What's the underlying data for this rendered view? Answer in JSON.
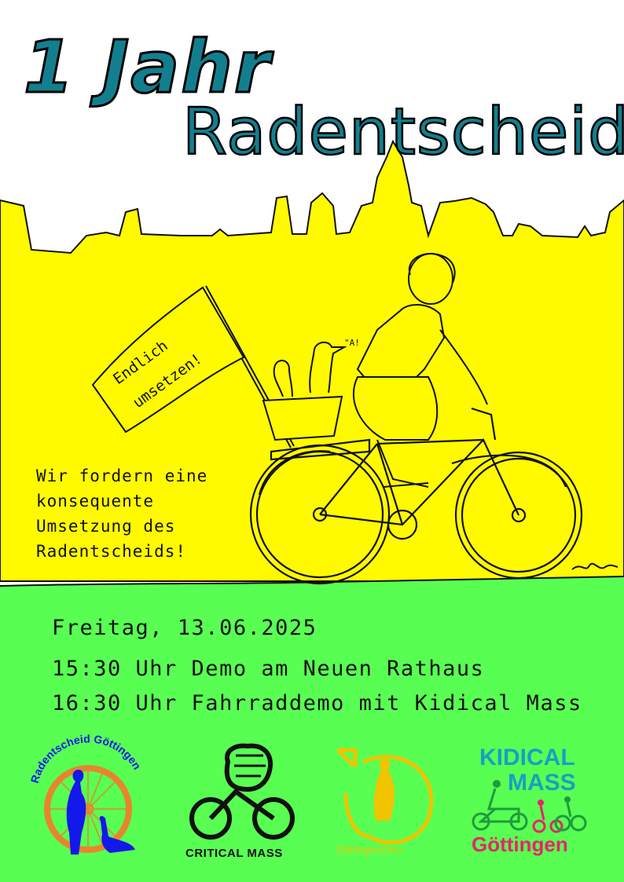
{
  "title": {
    "line1": "1 Jahr",
    "line2": "Radentscheid"
  },
  "flag_text": {
    "line1": "Endlich",
    "line2": "umsetzen!"
  },
  "goose_sound": "\"A!",
  "demand": {
    "line1": "Wir fordern eine",
    "line2": "konsequente",
    "line3": "Umsetzung des",
    "line4": "Radentscheids!"
  },
  "event": {
    "date": "Freitag, 13.06.2025",
    "line1": "15:30 Uhr Demo am Neuen Rathaus",
    "line2": "16:30 Uhr Fahrraddemo mit Kidical Mass"
  },
  "logos": {
    "radentscheid": "Radentscheid Göttingen",
    "critical_mass": "CRITICAL MASS",
    "goettingen_zero": "GöttingenZero",
    "kidical_line1": "KIDICAL",
    "kidical_line2": "MASS",
    "kidical_line3": "Göttingen"
  },
  "colors": {
    "yellow": "#fffa00",
    "green": "#58ff52",
    "teal": "#137f8e",
    "blue": "#1219ea",
    "orange": "#e8852c",
    "pink": "#e8246a",
    "kidical_blue": "#17a0c4",
    "kidical_green": "#1f9a3e"
  }
}
